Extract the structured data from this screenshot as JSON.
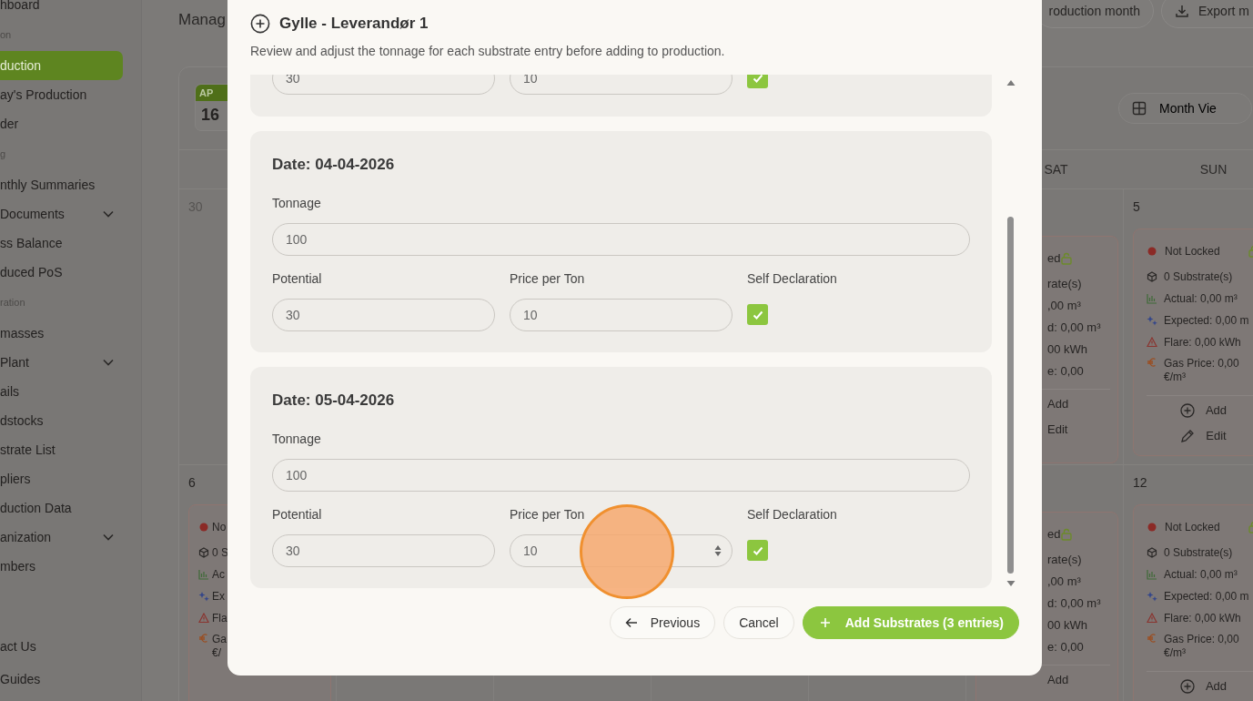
{
  "sidebar": {
    "items": [
      {
        "kind": "item",
        "label": "hboard",
        "selected": false,
        "expandable": false
      },
      {
        "kind": "section",
        "label": "on",
        "selected": false
      },
      {
        "kind": "item",
        "label": "duction",
        "selected": true,
        "expandable": false
      },
      {
        "kind": "item",
        "label": "ay's Production",
        "selected": false,
        "expandable": false
      },
      {
        "kind": "item",
        "label": "der",
        "selected": false,
        "expandable": false
      },
      {
        "kind": "section",
        "label": "g",
        "selected": false
      },
      {
        "kind": "item",
        "label": "nthly Summaries",
        "selected": false,
        "expandable": false
      },
      {
        "kind": "item",
        "label": "Documents",
        "selected": false,
        "expandable": true
      },
      {
        "kind": "item",
        "label": "ss Balance",
        "selected": false,
        "expandable": false
      },
      {
        "kind": "item",
        "label": "duced PoS",
        "selected": false,
        "expandable": false
      },
      {
        "kind": "section",
        "label": "ration",
        "selected": false
      },
      {
        "kind": "item",
        "label": "masses",
        "selected": false,
        "expandable": false
      },
      {
        "kind": "item",
        "label": "Plant",
        "selected": false,
        "expandable": true
      },
      {
        "kind": "item",
        "label": "ails",
        "selected": false,
        "expandable": false
      },
      {
        "kind": "item",
        "label": "dstocks",
        "selected": false,
        "expandable": false
      },
      {
        "kind": "item",
        "label": "strate List",
        "selected": false,
        "expandable": false
      },
      {
        "kind": "item",
        "label": "pliers",
        "selected": false,
        "expandable": false
      },
      {
        "kind": "item",
        "label": "duction Data",
        "selected": false,
        "expandable": false
      },
      {
        "kind": "item",
        "label": "anization",
        "selected": false,
        "expandable": true
      },
      {
        "kind": "item",
        "label": "mbers",
        "selected": false,
        "expandable": false
      }
    ],
    "footer_items": [
      {
        "kind": "item",
        "label": "act Us",
        "selected": false,
        "expandable": false
      },
      {
        "kind": "item",
        "label": "Guides",
        "selected": false,
        "expandable": false
      }
    ]
  },
  "header": {
    "title": "Manag",
    "buttons": [
      {
        "kind": "plain",
        "label": "roduction month"
      },
      {
        "kind": "download",
        "label": "Export m"
      }
    ]
  },
  "calendar": {
    "date_badge": {
      "month": "AP",
      "day": "16"
    },
    "view_button": "Month Vie",
    "weekdays": [
      "SAT",
      "SUN"
    ],
    "weeks": [
      {
        "cells": [
          {
            "kind": "left-part",
            "day": "30",
            "outside_month": true
          },
          {
            "kind": "right-part",
            "card": {
              "status": "ed",
              "locked": false,
              "lines": [
                "rate(s)",
                ",00 m³",
                "d: 0,00 m³",
                "00 kWh",
                "e: 0,00"
              ],
              "actions": [
                "Add",
                "Edit"
              ]
            }
          },
          {
            "kind": "full",
            "day": "5",
            "outside_month": false,
            "card": {
              "status": "Not Locked",
              "locked": false,
              "lines": [
                "0 Substrate(s)",
                "Actual: 0,00 m³",
                "Expected: 0,00 m",
                "Flare: 0,00 kWh",
                "Gas Price: 0,00 €/m³"
              ],
              "actions": [
                "Add",
                "Edit"
              ]
            }
          }
        ]
      },
      {
        "cells": [
          {
            "kind": "left-part",
            "day": "6",
            "outside_month": false,
            "card": {
              "status": "No",
              "locked": false,
              "lines": [
                "0 S",
                "Ac",
                "Ex",
                "Fla",
                "Ga €/"
              ]
            }
          },
          {
            "kind": "right-part",
            "card": {
              "status": "ed",
              "locked": false,
              "lines": [
                "rate(s)",
                ",00 m³",
                "d: 0,00 m³",
                "00 kWh",
                "e: 0,00"
              ],
              "actions": [
                "Add"
              ]
            }
          },
          {
            "kind": "full",
            "day": "12",
            "outside_month": false,
            "card": {
              "status": "Not Locked",
              "locked": false,
              "lines": [
                "0 Substrate(s)",
                "Actual: 0,00 m³",
                "Expected: 0,00 m",
                "Flare: 0,00 kWh",
                "Gas Price: 0,00 €/m³"
              ],
              "actions": [
                "Add"
              ]
            }
          }
        ]
      }
    ]
  },
  "modal": {
    "title": "Gylle - Leverandør 1",
    "subtitle": "Review and adjust the tonnage for each substrate entry before adding to production.",
    "entries": [
      {
        "kind": "partial",
        "potential": "30",
        "price": "10",
        "self_declaration": true,
        "show_spinner": false
      },
      {
        "kind": "full",
        "date": "Date: 04-04-2026",
        "tonnage_label": "Tonnage",
        "tonnage": "100",
        "potential_label": "Potential",
        "potential": "30",
        "price_label": "Price per Ton",
        "price": "10",
        "self_declaration_label": "Self Declaration",
        "self_declaration": true,
        "show_spinner": false
      },
      {
        "kind": "full",
        "date": "Date: 05-04-2026",
        "tonnage_label": "Tonnage",
        "tonnage": "100",
        "potential_label": "Potential",
        "potential": "30",
        "price_label": "Price per Ton",
        "price": "10",
        "self_declaration_label": "Self Declaration",
        "self_declaration": true,
        "show_spinner": true
      }
    ],
    "buttons": [
      {
        "kind": "back",
        "label": "Previous"
      },
      {
        "kind": "plain",
        "label": "Cancel"
      },
      {
        "kind": "primary",
        "label": "Add Substrates (3 entries)"
      }
    ]
  },
  "click_highlight": true
}
